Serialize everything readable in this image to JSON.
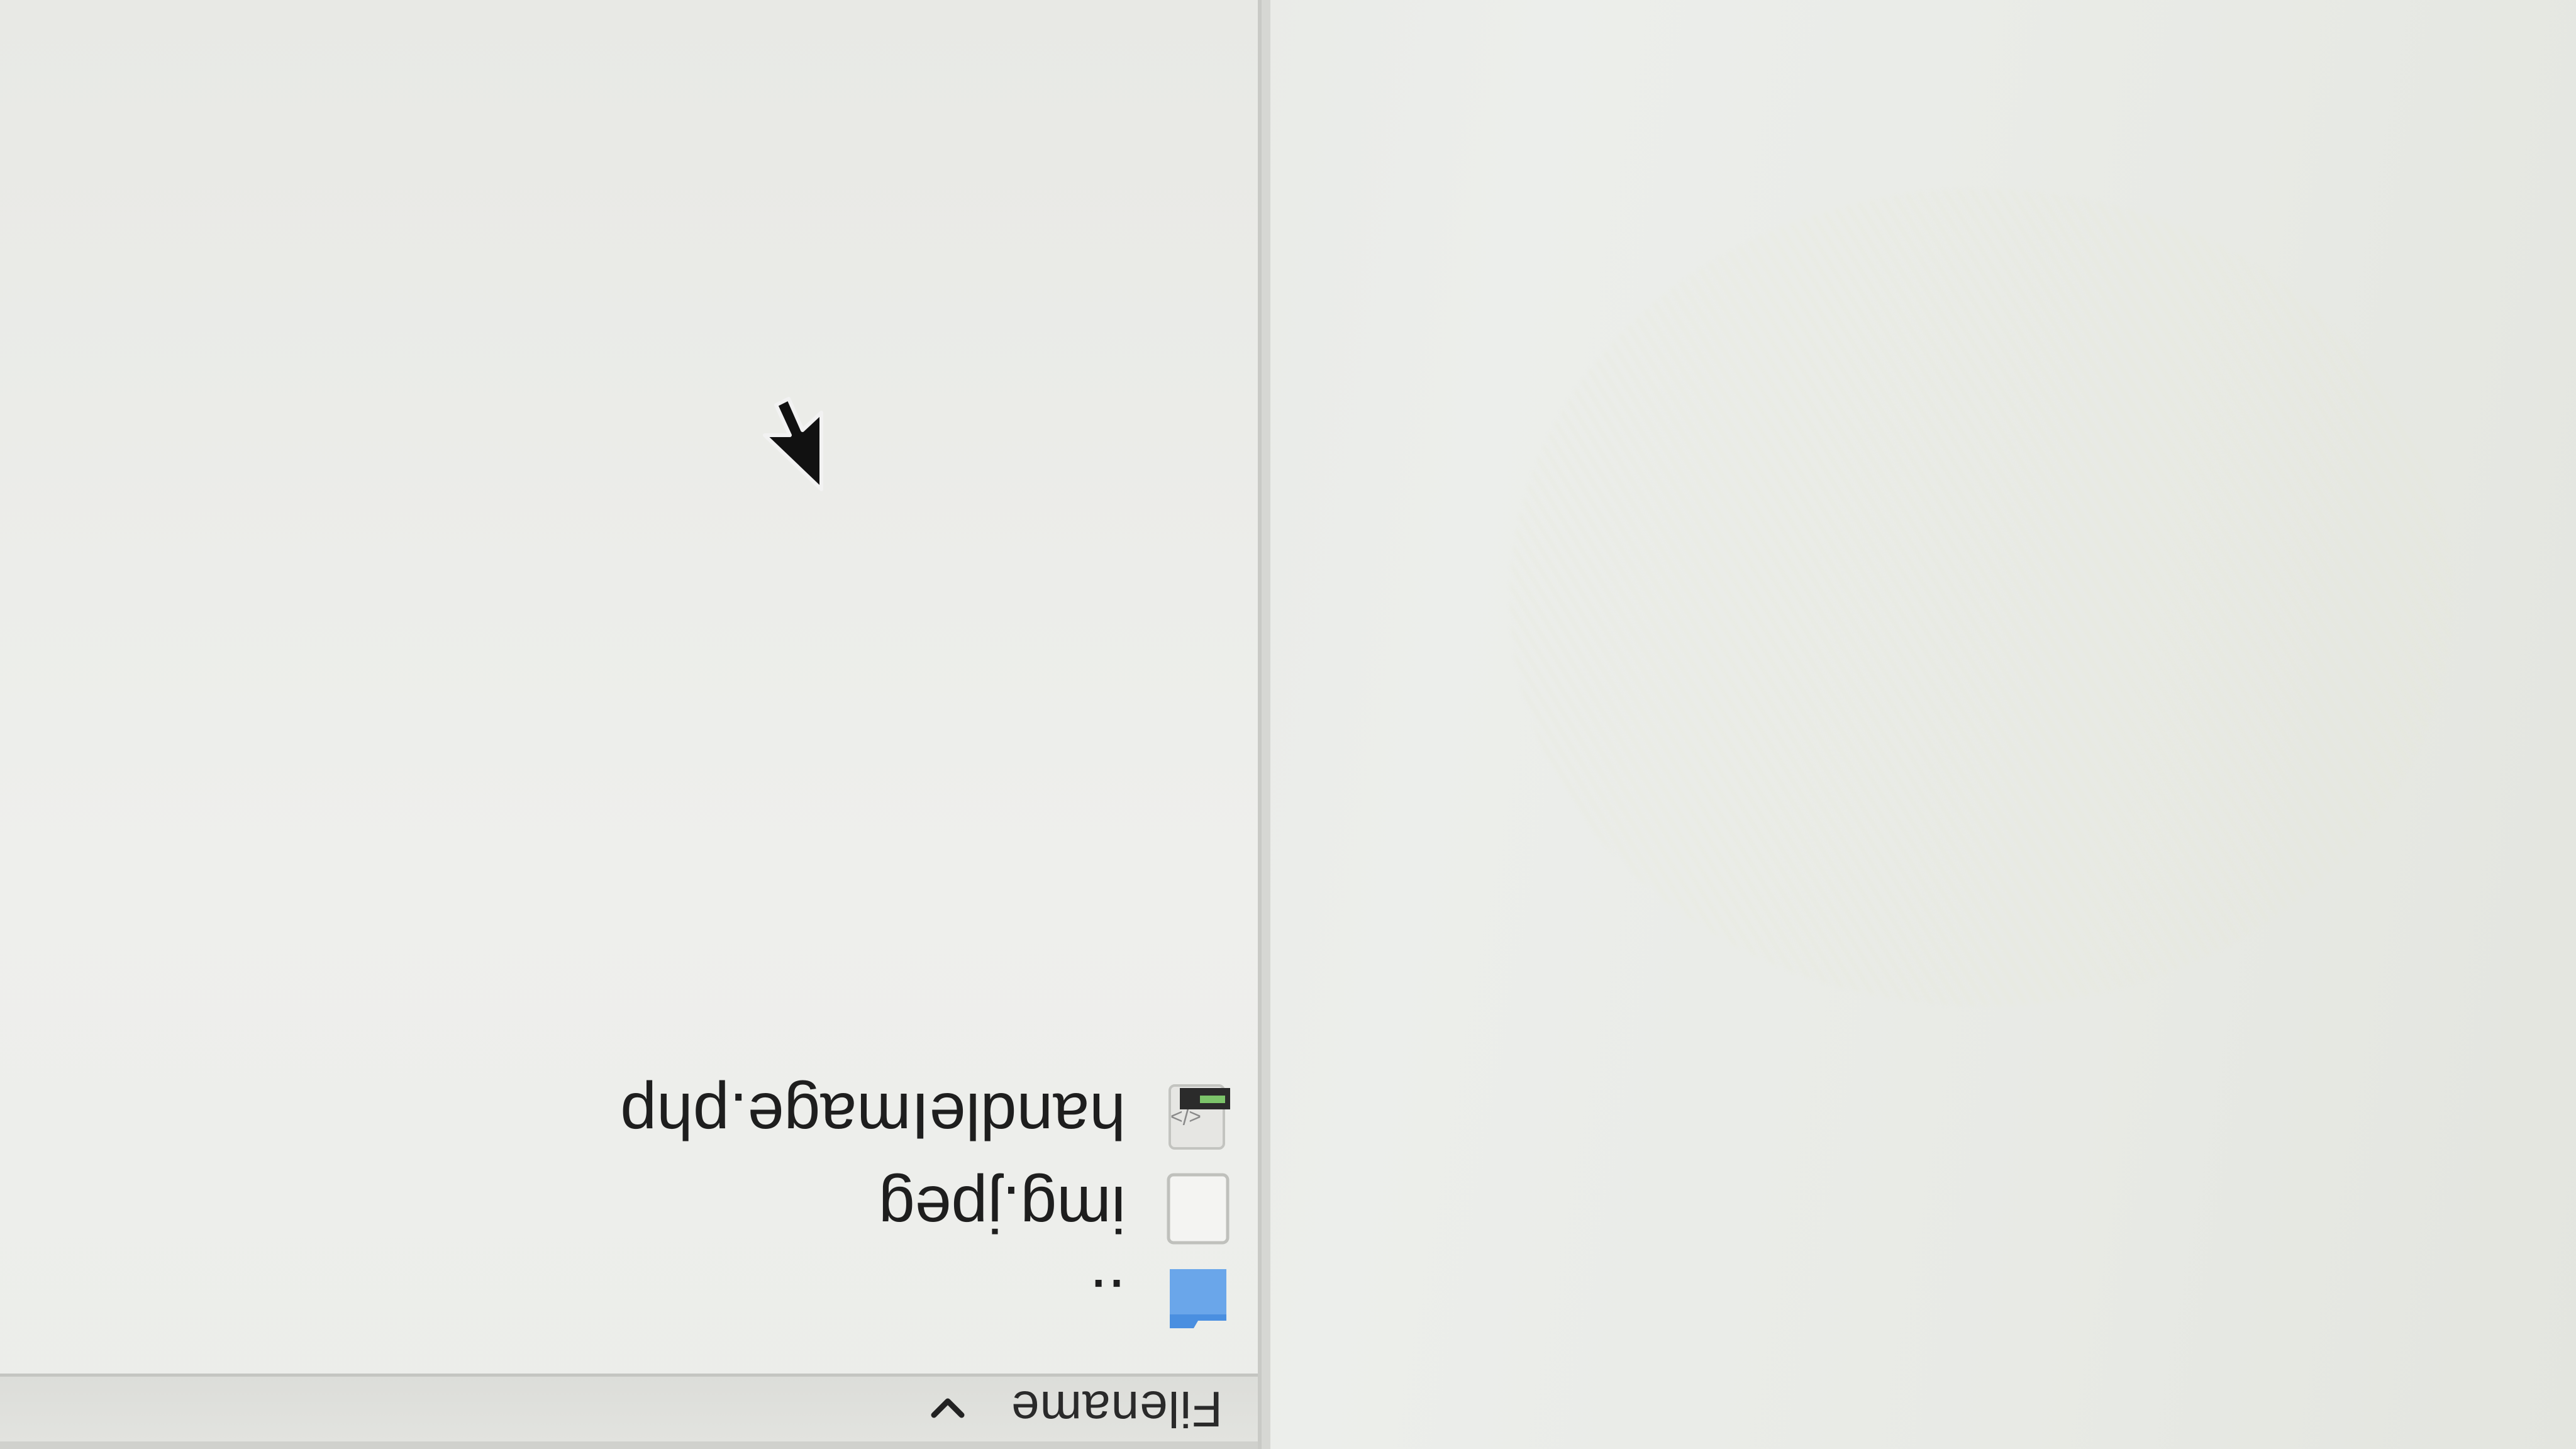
{
  "file_list": {
    "column_header": "Filename",
    "sort_indicator": "chevron-down-icon",
    "rows": [
      {
        "icon": "parent-folder-icon",
        "name": ".."
      },
      {
        "icon": "image-file-icon",
        "name": "img.jpeg"
      },
      {
        "icon": "php-file-icon",
        "name": "handleImage.php"
      }
    ]
  },
  "colors": {
    "folder_blue": "#4a8fe0",
    "php_badge": "#2b2b2b",
    "php_badge_text": "#7cc46a"
  }
}
